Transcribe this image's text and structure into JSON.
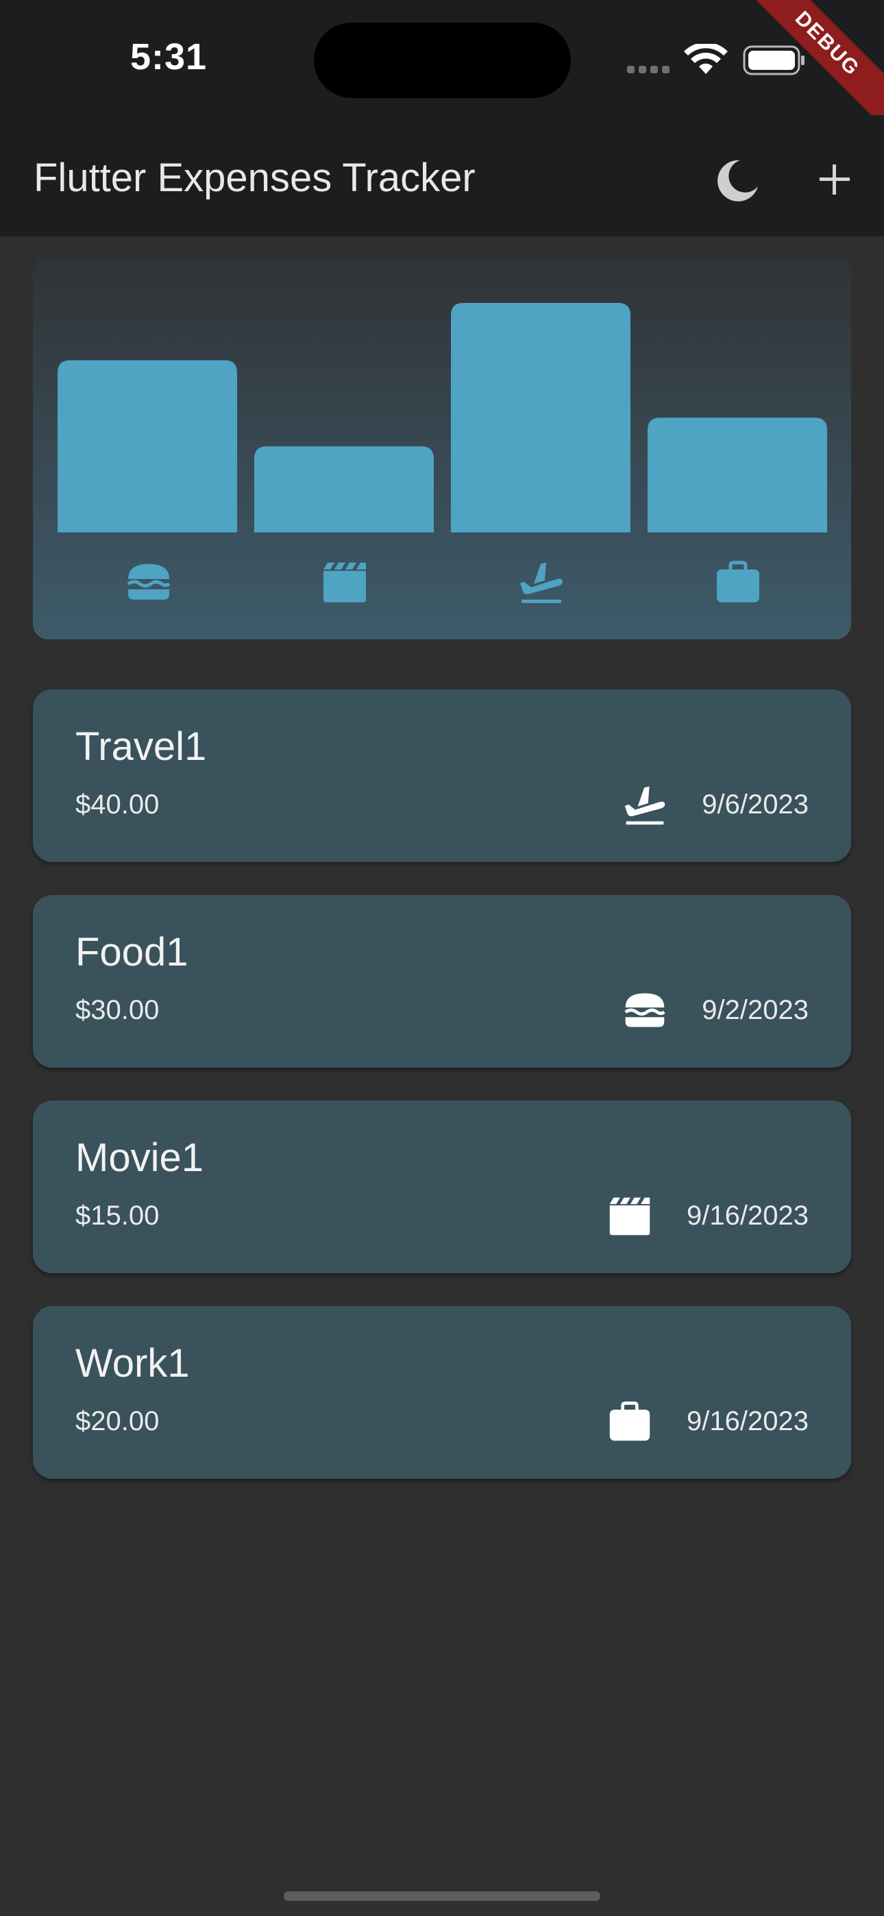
{
  "status_bar": {
    "time": "5:31",
    "debug_label": "DEBUG"
  },
  "app_bar": {
    "title": "Flutter Expenses Tracker",
    "theme_toggle_icon": "moon-icon",
    "add_icon": "plus-icon"
  },
  "colors": {
    "accent": "#4fa3c3",
    "card": "#39525c",
    "background": "#2f2f2f",
    "app_bar": "#1b1d1f"
  },
  "chart_data": {
    "type": "bar",
    "categories": [
      "food",
      "leisure",
      "travel",
      "work"
    ],
    "category_icons": [
      "burger-icon",
      "movie-clapper-icon",
      "flight-takeoff-icon",
      "briefcase-icon"
    ],
    "values": [
      30,
      15,
      40,
      20
    ],
    "ylim": [
      0,
      40
    ],
    "title": "",
    "xlabel": "",
    "ylabel": ""
  },
  "expenses": [
    {
      "title": "Travel1",
      "amount": "$40.00",
      "date": "9/6/2023",
      "icon": "flight-takeoff-icon"
    },
    {
      "title": "Food1",
      "amount": "$30.00",
      "date": "9/2/2023",
      "icon": "burger-icon"
    },
    {
      "title": "Movie1",
      "amount": "$15.00",
      "date": "9/16/2023",
      "icon": "movie-clapper-icon"
    },
    {
      "title": "Work1",
      "amount": "$20.00",
      "date": "9/16/2023",
      "icon": "briefcase-icon"
    }
  ]
}
